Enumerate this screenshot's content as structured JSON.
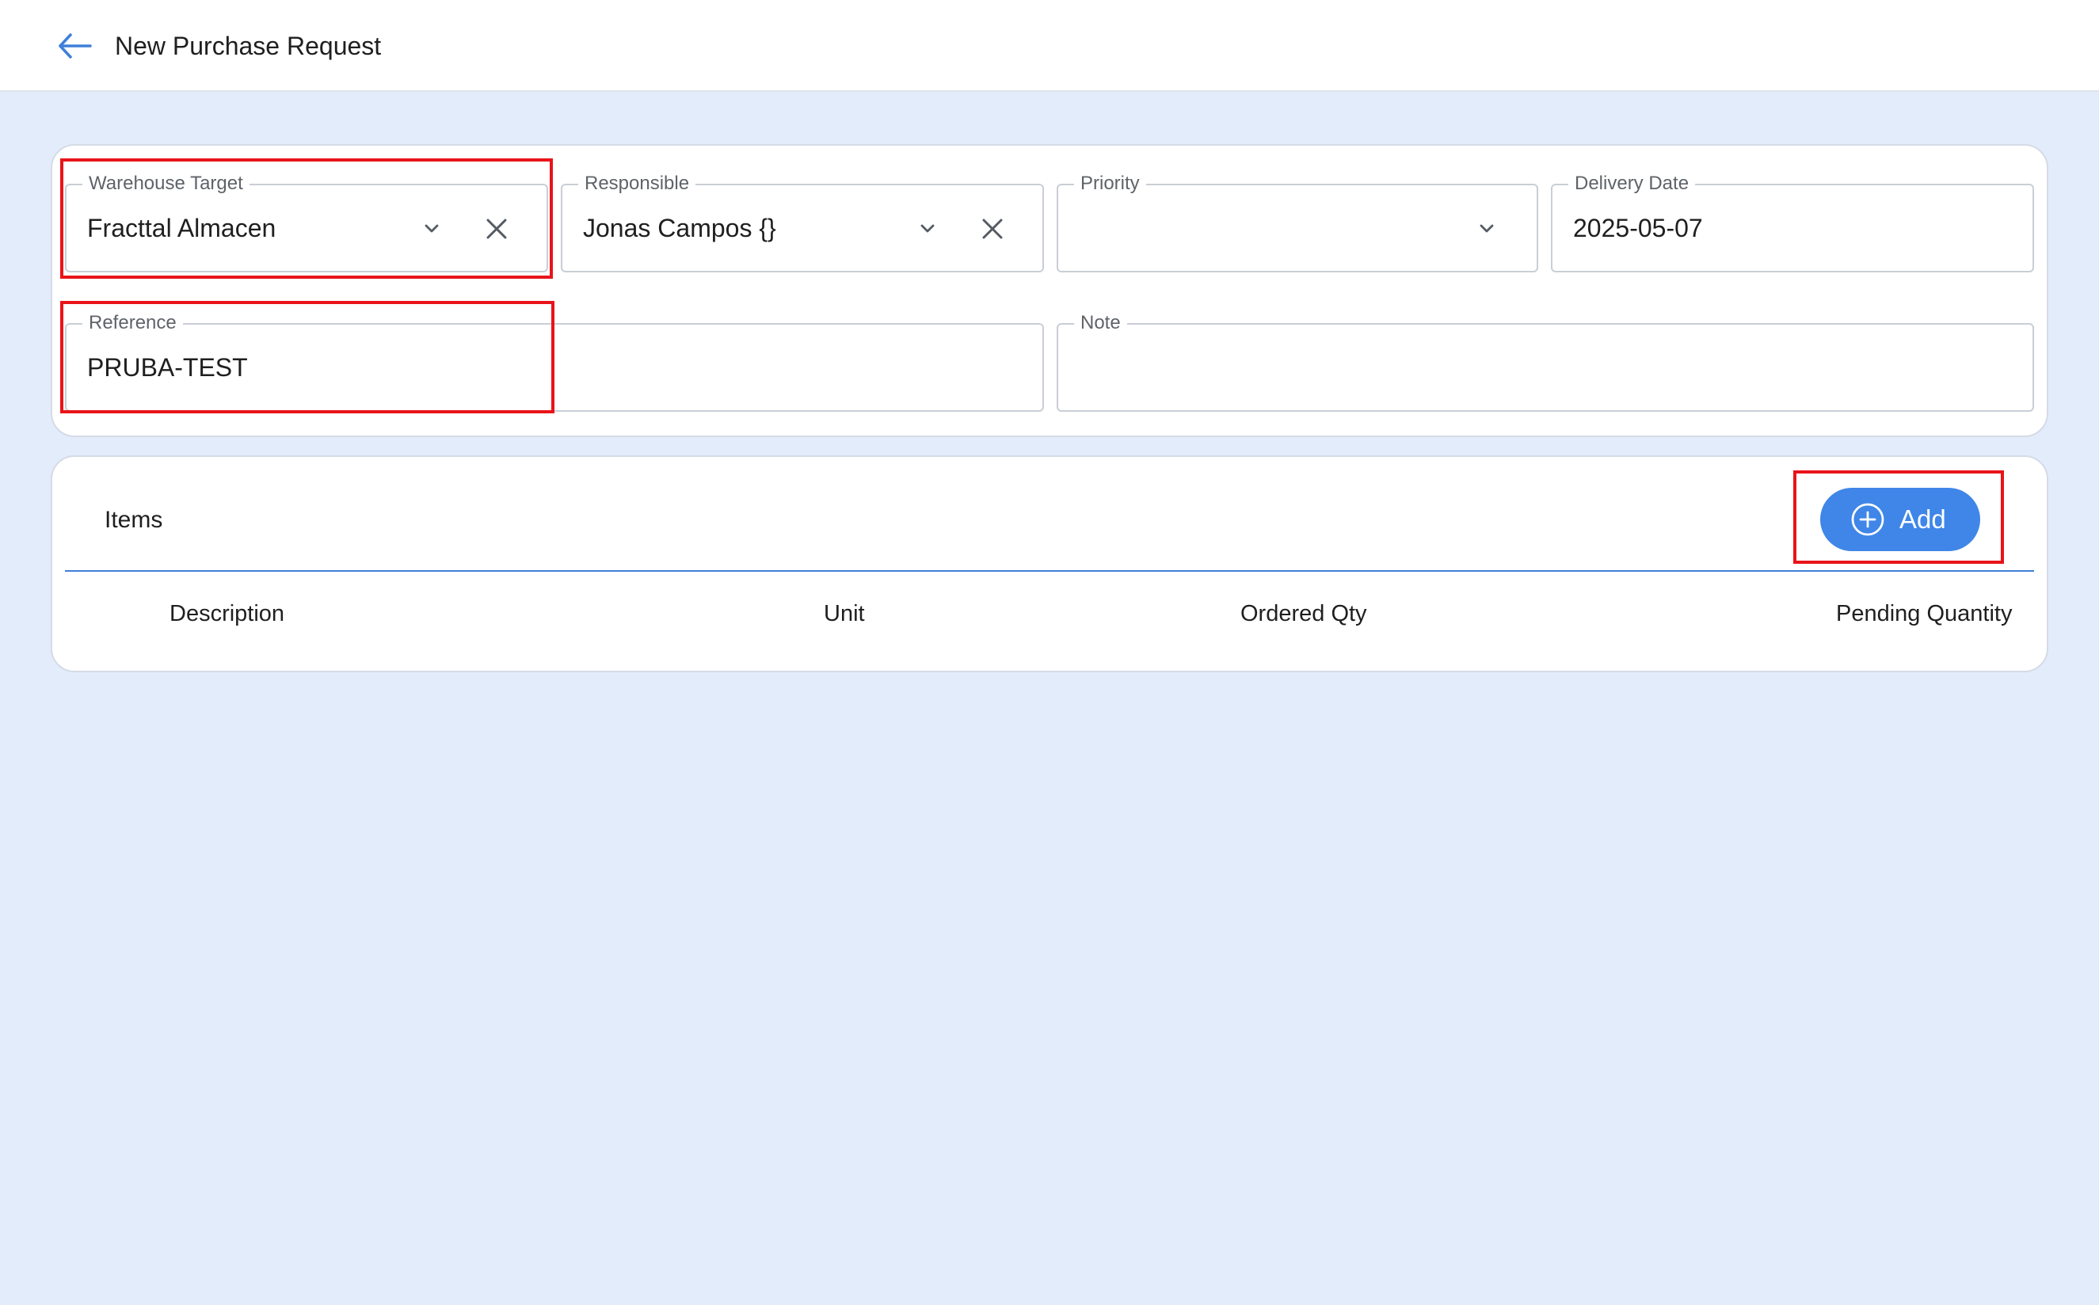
{
  "header": {
    "title": "New Purchase Request",
    "back_icon": "arrow-left-icon"
  },
  "form": {
    "warehouse_target": {
      "label": "Warehouse Target",
      "value": "Fracttal Almacen"
    },
    "responsible": {
      "label": "Responsible",
      "value": "Jonas Campos {}"
    },
    "priority": {
      "label": "Priority",
      "value": ""
    },
    "delivery_date": {
      "label": "Delivery Date",
      "value": "2025-05-07"
    },
    "reference": {
      "label": "Reference",
      "value": "PRUBA-TEST"
    },
    "note": {
      "label": "Note",
      "value": ""
    }
  },
  "items": {
    "title": "Items",
    "add_label": "Add",
    "columns": [
      "Description",
      "Unit",
      "Ordered Qty",
      "Pending Quantity"
    ]
  },
  "colors": {
    "accent": "#3f86e8",
    "background": "#e3ecfb",
    "highlight": "#e8141a"
  }
}
